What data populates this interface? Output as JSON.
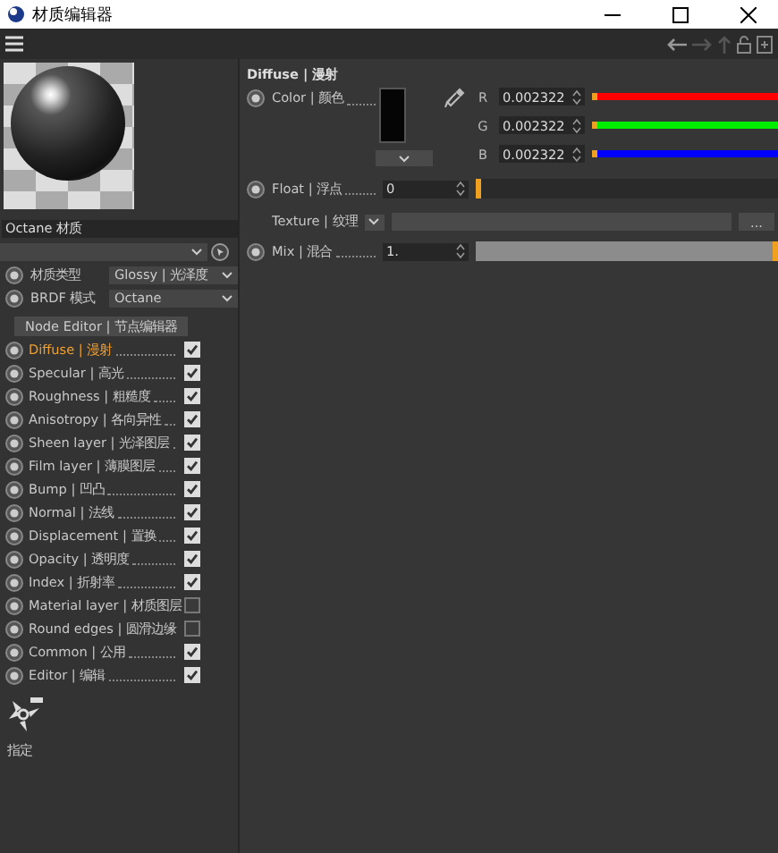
{
  "window": {
    "title": "材质编辑器"
  },
  "material": {
    "name": "Octane 材质",
    "type_label": "材质类型",
    "type_value": "Glossy | 光泽度",
    "brdf_label": "BRDF 模式",
    "brdf_value": "Octane",
    "node_editor": "Node Editor | 节点编辑器"
  },
  "channels": [
    {
      "label": "Diffuse | 漫射",
      "selected": true,
      "checked": true
    },
    {
      "label": "Specular | 高光",
      "selected": false,
      "checked": true
    },
    {
      "label": "Roughness | 粗糙度",
      "selected": false,
      "checked": true
    },
    {
      "label": "Anisotropy | 各向异性",
      "selected": false,
      "checked": true
    },
    {
      "label": "Sheen layer | 光泽图层",
      "selected": false,
      "checked": true
    },
    {
      "label": "Film layer | 薄膜图层",
      "selected": false,
      "checked": true
    },
    {
      "label": "Bump | 凹凸",
      "selected": false,
      "checked": true
    },
    {
      "label": "Normal | 法线",
      "selected": false,
      "checked": true
    },
    {
      "label": "Displacement | 置换",
      "selected": false,
      "checked": true
    },
    {
      "label": "Opacity | 透明度",
      "selected": false,
      "checked": true
    },
    {
      "label": "Index | 折射率",
      "selected": false,
      "checked": true
    },
    {
      "label": "Material layer | 材质图层",
      "selected": false,
      "checked": false
    },
    {
      "label": "Round edges | 圆滑边缘",
      "selected": false,
      "checked": false
    },
    {
      "label": "Common | 公用",
      "selected": false,
      "checked": true
    },
    {
      "label": "Editor | 编辑",
      "selected": false,
      "checked": true
    }
  ],
  "help": {
    "label": "指定"
  },
  "diffuse": {
    "title": "Diffuse | 漫射",
    "color_label": "Color | 颜色",
    "components": [
      {
        "name": "R",
        "value": "0.002322",
        "level": 0.0023,
        "color": "#ff0000"
      },
      {
        "name": "G",
        "value": "0.002322",
        "level": 0.0023,
        "color": "#00ee00"
      },
      {
        "name": "B",
        "value": "0.002322",
        "level": 0.0023,
        "color": "#0000ff"
      }
    ],
    "float": {
      "label": "Float | 浮点",
      "value": "0",
      "level": 0
    },
    "texture": {
      "label": "Texture | 纹理",
      "button": "..."
    },
    "mix": {
      "label": "Mix | 混合",
      "value": "1.",
      "level": 1
    }
  }
}
